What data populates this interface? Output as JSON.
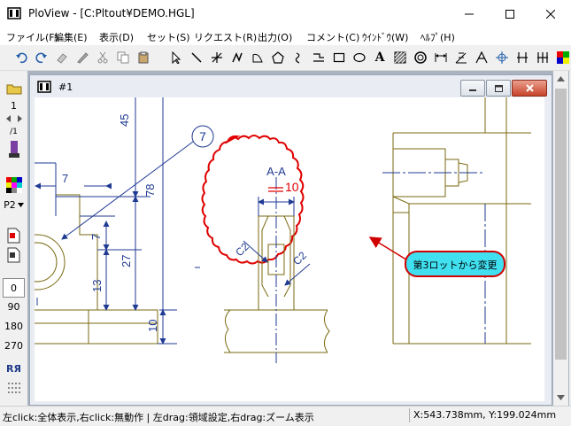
{
  "app": {
    "title": "PloView - [C:Pltout¥DEMO.HGL]"
  },
  "menu": [
    "ファイル(F)",
    "編集(E)",
    "表示(D)",
    "セット(S)",
    "リクエスト(R)",
    "出力(O)",
    "コメント(C)",
    "ｳｲﾝﾄﾞｳ(W)",
    "ﾍﾙﾌﾟ(H)"
  ],
  "left_toolbar": {
    "page_value": "1",
    "p2_label": "P2",
    "rotations": [
      "0",
      "90",
      "180",
      "270"
    ]
  },
  "child_window": {
    "title": "#1"
  },
  "drawing": {
    "dims": [
      "45",
      "7",
      "78",
      "7",
      "27",
      "13",
      "10"
    ],
    "balloon": "7",
    "section_label": "A-A",
    "rev_mark": "10",
    "chamfer_left": "C2",
    "chamfer_right": "C2",
    "note": "第3ロットから変更",
    "colors": {
      "dim": "#1f3a93",
      "outline": "#7a6a12",
      "cloud": "#e00000",
      "note_fill": "#40e0f0",
      "note_stroke": "#d00000"
    }
  },
  "status": {
    "hint": "左click:全体表示,右click:無動作 | 左drag:領域設定,右drag:ズーム表示",
    "coords": "X:543.738mm, Y:199.024mm"
  }
}
